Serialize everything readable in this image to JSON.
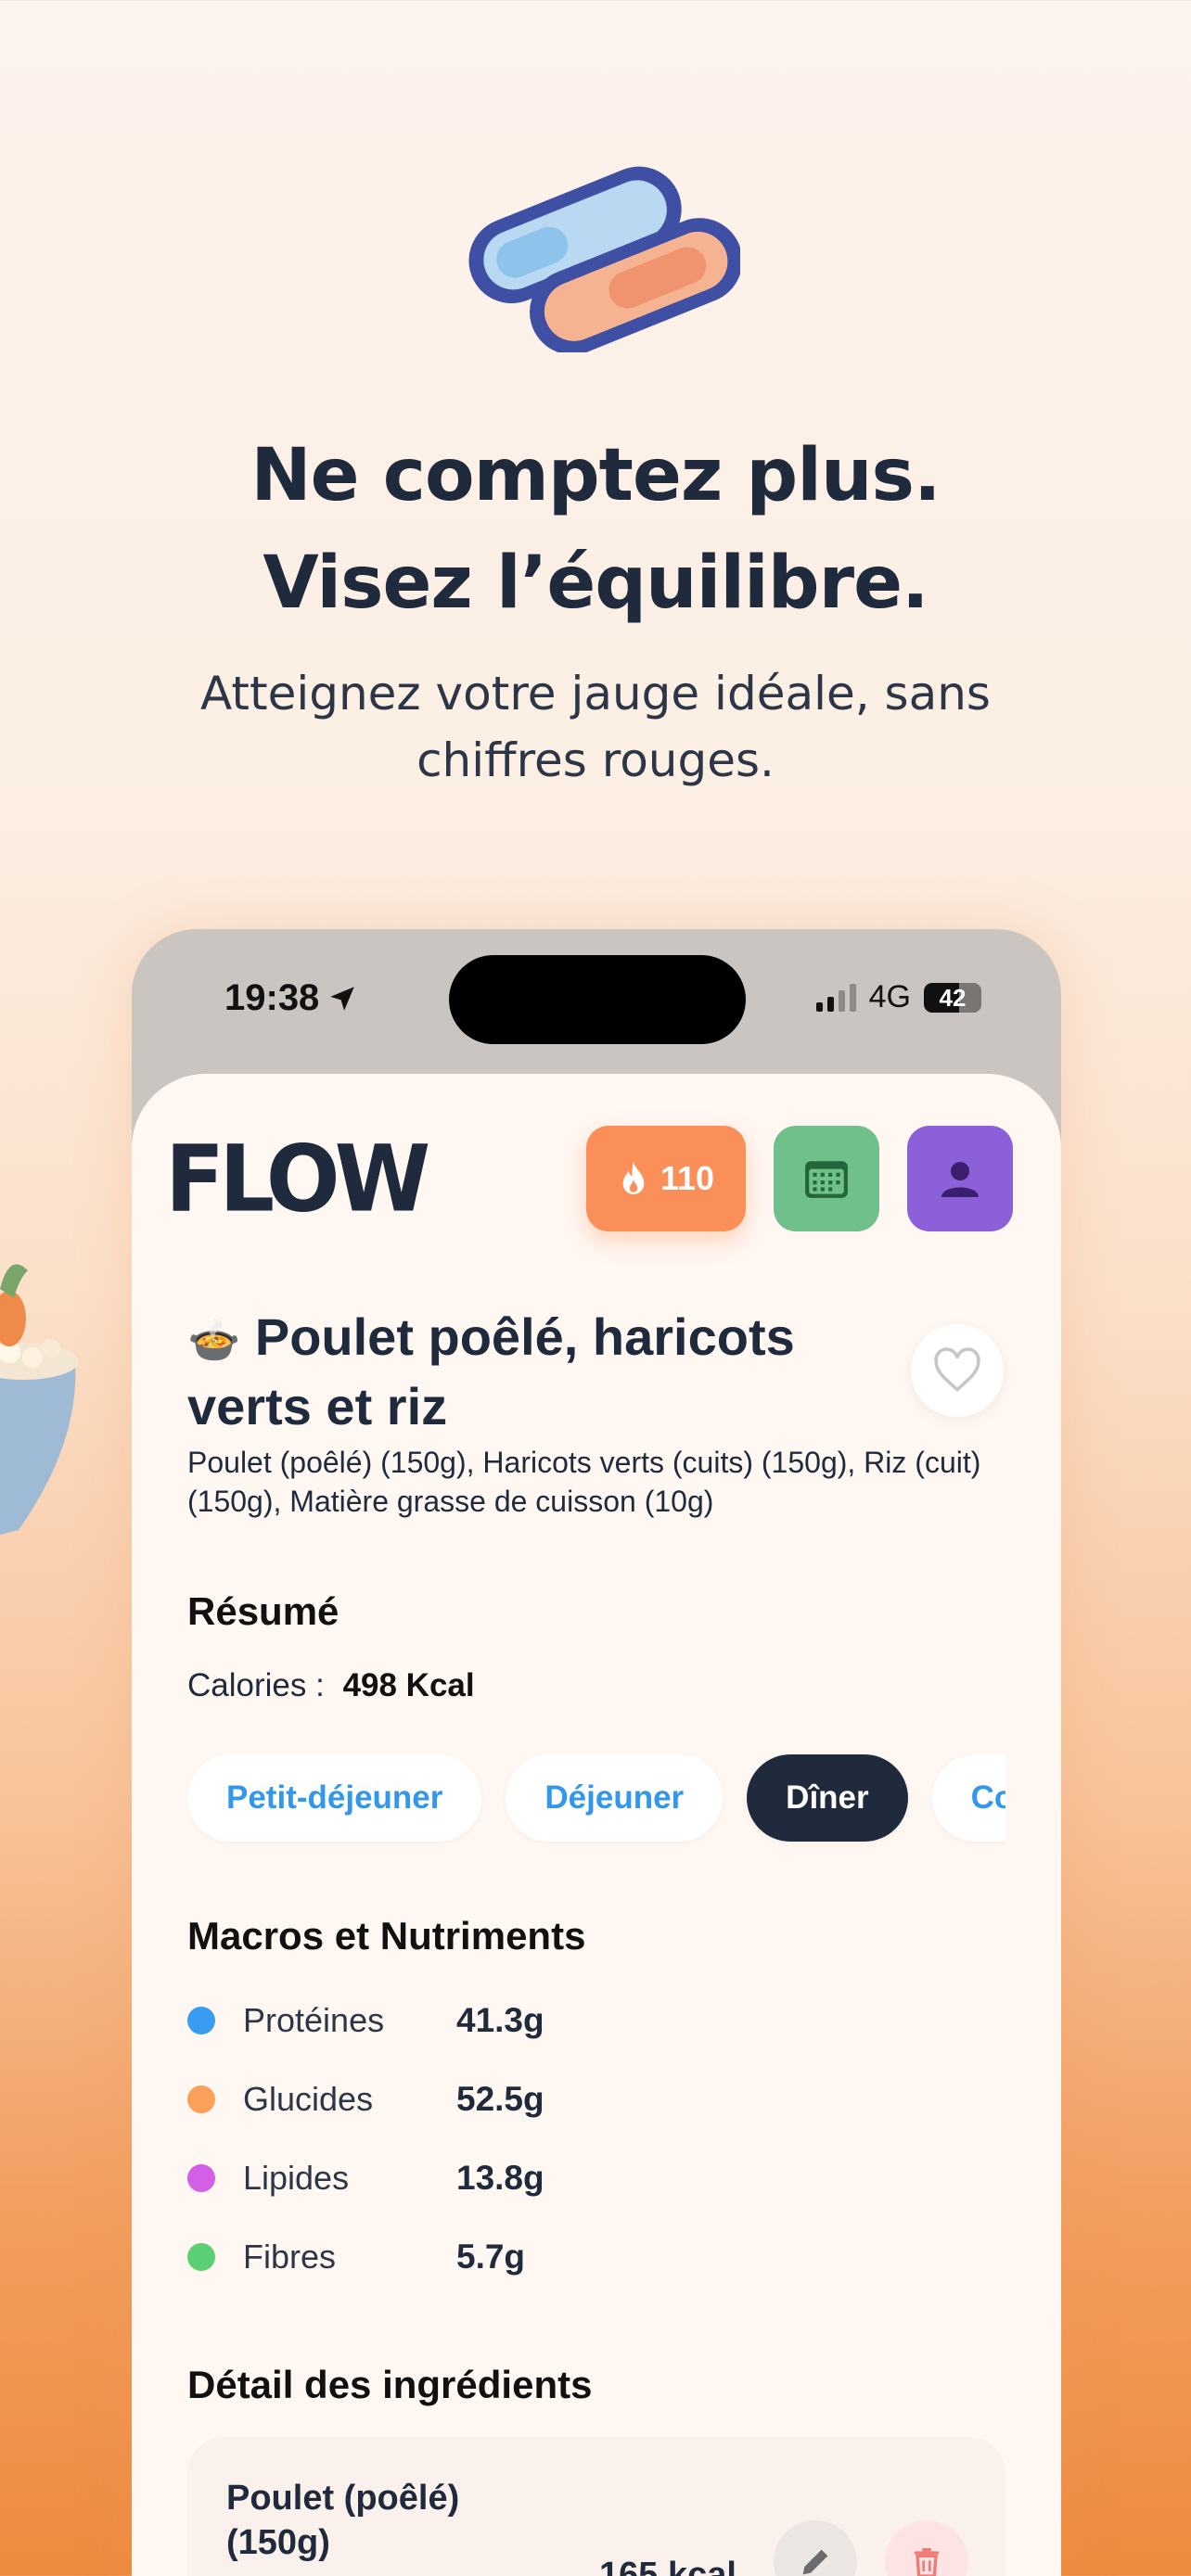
{
  "hero": {
    "headline_line1": "Ne comptez plus.",
    "headline_line2": "Visez l’équilibre.",
    "subline_line1": "Atteignez votre jauge idéale, sans",
    "subline_line2": "chiffres rouges.",
    "icon": "gauge-pill-icon"
  },
  "status_bar": {
    "time": "19:38",
    "network": "4G",
    "battery": "42"
  },
  "header": {
    "logo": "FLOW",
    "streak_count": "110",
    "streak_icon": "flame-icon",
    "calendar_icon": "calendar-icon",
    "profile_icon": "person-icon",
    "colors": {
      "streak": "#fb8f59",
      "calendar": "#6fc08a",
      "profile": "#8c60d8"
    }
  },
  "meal": {
    "emoji": "🍲",
    "title": "Poulet poêlé, haricots verts et riz",
    "description": "Poulet (poêlé) (150g), Haricots verts (cuits) (150g), Riz (cuit) (150g), Matière grasse de cuisson (10g)"
  },
  "summary": {
    "title": "Résumé",
    "calories_label": "Calories :",
    "calories_value": "498 Kcal"
  },
  "meal_types": [
    {
      "label": "Petit-déjeuner",
      "active": false
    },
    {
      "label": "Déjeuner",
      "active": false
    },
    {
      "label": "Dîner",
      "active": true
    },
    {
      "label": "Collation",
      "active": false
    }
  ],
  "macros": {
    "title": "Macros et Nutriments",
    "items": [
      {
        "name": "Protéines",
        "value": "41.3g",
        "color": "#3a9cf0"
      },
      {
        "name": "Glucides",
        "value": "52.5g",
        "color": "#fba05a"
      },
      {
        "name": "Lipides",
        "value": "13.8g",
        "color": "#d25fe6"
      },
      {
        "name": "Fibres",
        "value": "5.7g",
        "color": "#5bcf73"
      }
    ]
  },
  "ingredients": {
    "title": "Détail des ingrédients",
    "items": [
      {
        "name": "Poulet (poêlé) (150g)",
        "kcal": "165 kcal"
      }
    ]
  }
}
